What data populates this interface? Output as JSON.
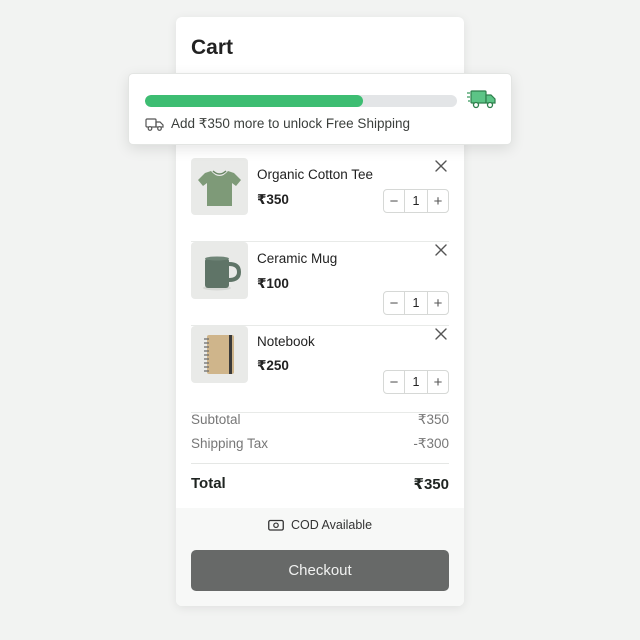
{
  "cart": {
    "title": "Cart"
  },
  "shipping": {
    "progress_fraction": 0.7,
    "message": "Add ₹350 more to unlock Free Shipping",
    "icon_main": "delivery-truck-icon",
    "icon_small": "truck-icon"
  },
  "items": [
    {
      "name": "Organic Cotton Tee",
      "price": "₹350",
      "quantity": "1",
      "thumbnail": "t-shirt"
    },
    {
      "name": "Ceramic Mug",
      "price": "₹100",
      "quantity": "1",
      "thumbnail": "mug"
    },
    {
      "name": "Notebook",
      "price": "₹250",
      "quantity": "1",
      "thumbnail": "notebook"
    }
  ],
  "stepper": {
    "minus": "−",
    "plus": "+"
  },
  "summary": {
    "subtotal_label": "Subtotal",
    "subtotal_value": "₹350",
    "shipping_label": "Shipping Tax",
    "shipping_value": "-₹300",
    "total_label": "Total",
    "total_value": "₹350"
  },
  "footer": {
    "cod_label": "COD Available",
    "checkout_label": "Checkout"
  },
  "colors": {
    "accent_green": "#3dbd72",
    "checkout_bg": "#676968",
    "track": "#e3e5e7"
  }
}
